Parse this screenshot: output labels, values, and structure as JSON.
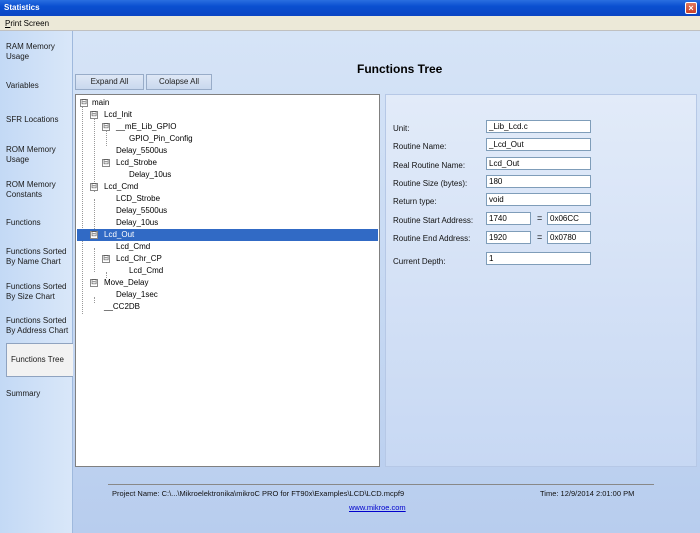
{
  "window": {
    "title": "Statistics",
    "close_glyph": "×"
  },
  "menu": {
    "print_screen_first": "P",
    "print_screen_rest": "rint Screen"
  },
  "sidebar": {
    "items": [
      "RAM Memory Usage",
      "Variables",
      "SFR Locations",
      "ROM Memory Usage",
      "ROM Memory Constants",
      "Functions",
      "Functions Sorted By Name Chart",
      "Functions Sorted By Size Chart",
      "Functions Sorted By Address Chart",
      "Functions Tree",
      "Summary"
    ],
    "active": "Functions Tree"
  },
  "main": {
    "title": "Functions Tree",
    "expand_all": "Expand All",
    "collapse_all": "Colapse All"
  },
  "tree": {
    "nodes": [
      "main",
      "Lcd_Init",
      "__mE_Lib_GPIO",
      "GPIO_Pin_Config",
      "Delay_5500us",
      "Lcd_Strobe",
      "Delay_10us",
      "Lcd_Cmd",
      "LCD_Strobe",
      "Delay_5500us",
      "Delay_10us",
      "Lcd_Out",
      "Lcd_Cmd",
      "Lcd_Chr_CP",
      "Lcd_Cmd",
      "Move_Delay",
      "Delay_1sec",
      "__CC2DB"
    ],
    "selected": "Lcd_Out",
    "expander": "⊟"
  },
  "details": {
    "unit_label": "Unit:",
    "unit_value": "_Lib_Lcd.c",
    "routine_name_label": "Routine Name:",
    "routine_name_value": "_Lcd_Out",
    "real_routine_name_label": "Real Routine Name:",
    "real_routine_name_value": "Lcd_Out",
    "routine_size_label": "Routine Size (bytes):",
    "routine_size_value": "180",
    "return_type_label": "Return type:",
    "return_type_value": "void",
    "start_address_label": "Routine Start Address:",
    "start_address_dec": "1740",
    "start_address_hex": "0x06CC",
    "end_address_label": "Routine End Address:",
    "end_address_dec": "1920",
    "end_address_hex": "0x0780",
    "equals": "=",
    "current_depth_label": "Current Depth:",
    "current_depth_value": "1"
  },
  "footer": {
    "project": "Project Name: C:\\...\\Mikroelektronika\\mikroC PRO for FT90x\\Examples\\LCD\\LCD.mcpf9",
    "time": "Time: 12/9/2014 2:01:00 PM",
    "link": "www.mikroe.com"
  }
}
